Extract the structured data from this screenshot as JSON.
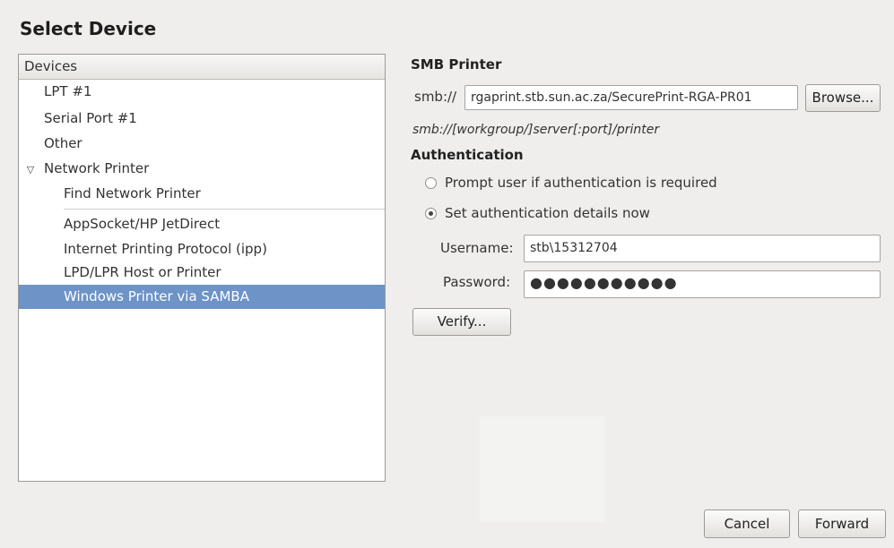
{
  "window": {
    "title": "Select Device"
  },
  "devices": {
    "header": "Devices",
    "items": [
      {
        "label": "LPT #1",
        "expander": ""
      },
      {
        "label": "Serial Port #1",
        "expander": ""
      },
      {
        "label": "Other",
        "expander": ""
      },
      {
        "label": "Network Printer",
        "expander": "▽"
      },
      {
        "label": "Find Network Printer",
        "expander": ""
      },
      {
        "label": "AppSocket/HP JetDirect",
        "expander": ""
      },
      {
        "label": "Internet Printing Protocol (ipp)",
        "expander": ""
      },
      {
        "label": "LPD/LPR Host or Printer",
        "expander": ""
      },
      {
        "label": "Windows Printer via SAMBA",
        "expander": ""
      }
    ],
    "selected_index": 8
  },
  "smb": {
    "title": "SMB Printer",
    "prefix": "smb://",
    "uri_value": "rgaprint.stb.sun.ac.za/SecurePrint-RGA-PR01",
    "browse_label": "Browse...",
    "hint": "smb://[workgroup/]server[:port]/printer"
  },
  "auth": {
    "title": "Authentication",
    "option_prompt": "Prompt user if authentication is required",
    "option_set": "Set authentication details now",
    "selected": "set",
    "username_label": "Username:",
    "username_value": "stb\\15312704",
    "password_label": "Password:",
    "password_value": "●●●●●●●●●●●",
    "verify_label": "Verify..."
  },
  "footer": {
    "cancel_label": "Cancel",
    "forward_label": "Forward"
  }
}
